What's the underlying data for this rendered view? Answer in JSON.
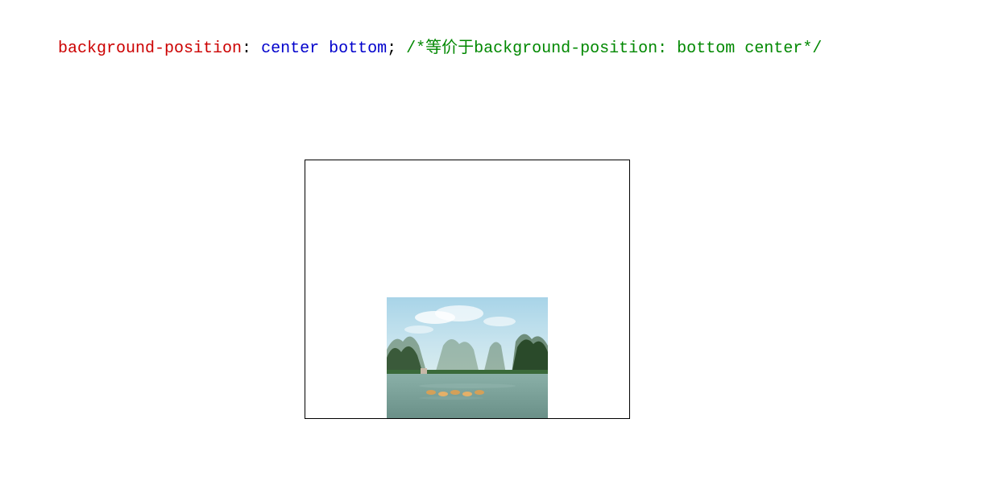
{
  "code": {
    "property": "background-position",
    "colon": ":",
    "space1": " ",
    "value": "center bottom",
    "semicolon": ";",
    "space2": " ",
    "comment": "/*等价于background-position: bottom center*/"
  }
}
